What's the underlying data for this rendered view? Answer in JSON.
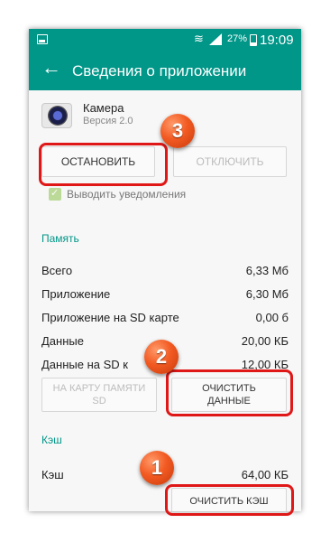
{
  "statusbar": {
    "battery": "27%",
    "time": "19:09"
  },
  "appbar": {
    "back": "←",
    "title": "Сведения о приложении"
  },
  "app": {
    "name": "Камера",
    "version": "Версия 2.0"
  },
  "buttons": {
    "stop": "ОСТАНОВИТЬ",
    "disable": "ОТКЛЮЧИТЬ",
    "move_sd_line1": "НА КАРТУ ПАМЯТИ",
    "move_sd_line2": "SD",
    "clear_data_line1": "ОЧИСТИТЬ",
    "clear_data_line2": "ДАННЫЕ",
    "clear_cache": "ОЧИСТИТЬ КЭШ"
  },
  "notifications": {
    "label": "Выводить уведомления",
    "checked": true
  },
  "memory": {
    "title": "Память",
    "rows": [
      {
        "label": "Всего",
        "value": "6,33 Мб"
      },
      {
        "label": "Приложение",
        "value": "6,30 Мб"
      },
      {
        "label": "Приложение на SD карте",
        "value": "0,00 б"
      },
      {
        "label": "Данные",
        "value": "20,00 КБ"
      },
      {
        "label": "Данные на SD к",
        "value": "12,00 КБ"
      }
    ]
  },
  "cache": {
    "title": "Кэш",
    "label": "Кэш",
    "value": "64,00 КБ"
  },
  "badges": [
    "3",
    "2",
    "1"
  ],
  "colors": {
    "accent": "#009688",
    "highlight": "#e01717",
    "badge": "#f25a22"
  }
}
